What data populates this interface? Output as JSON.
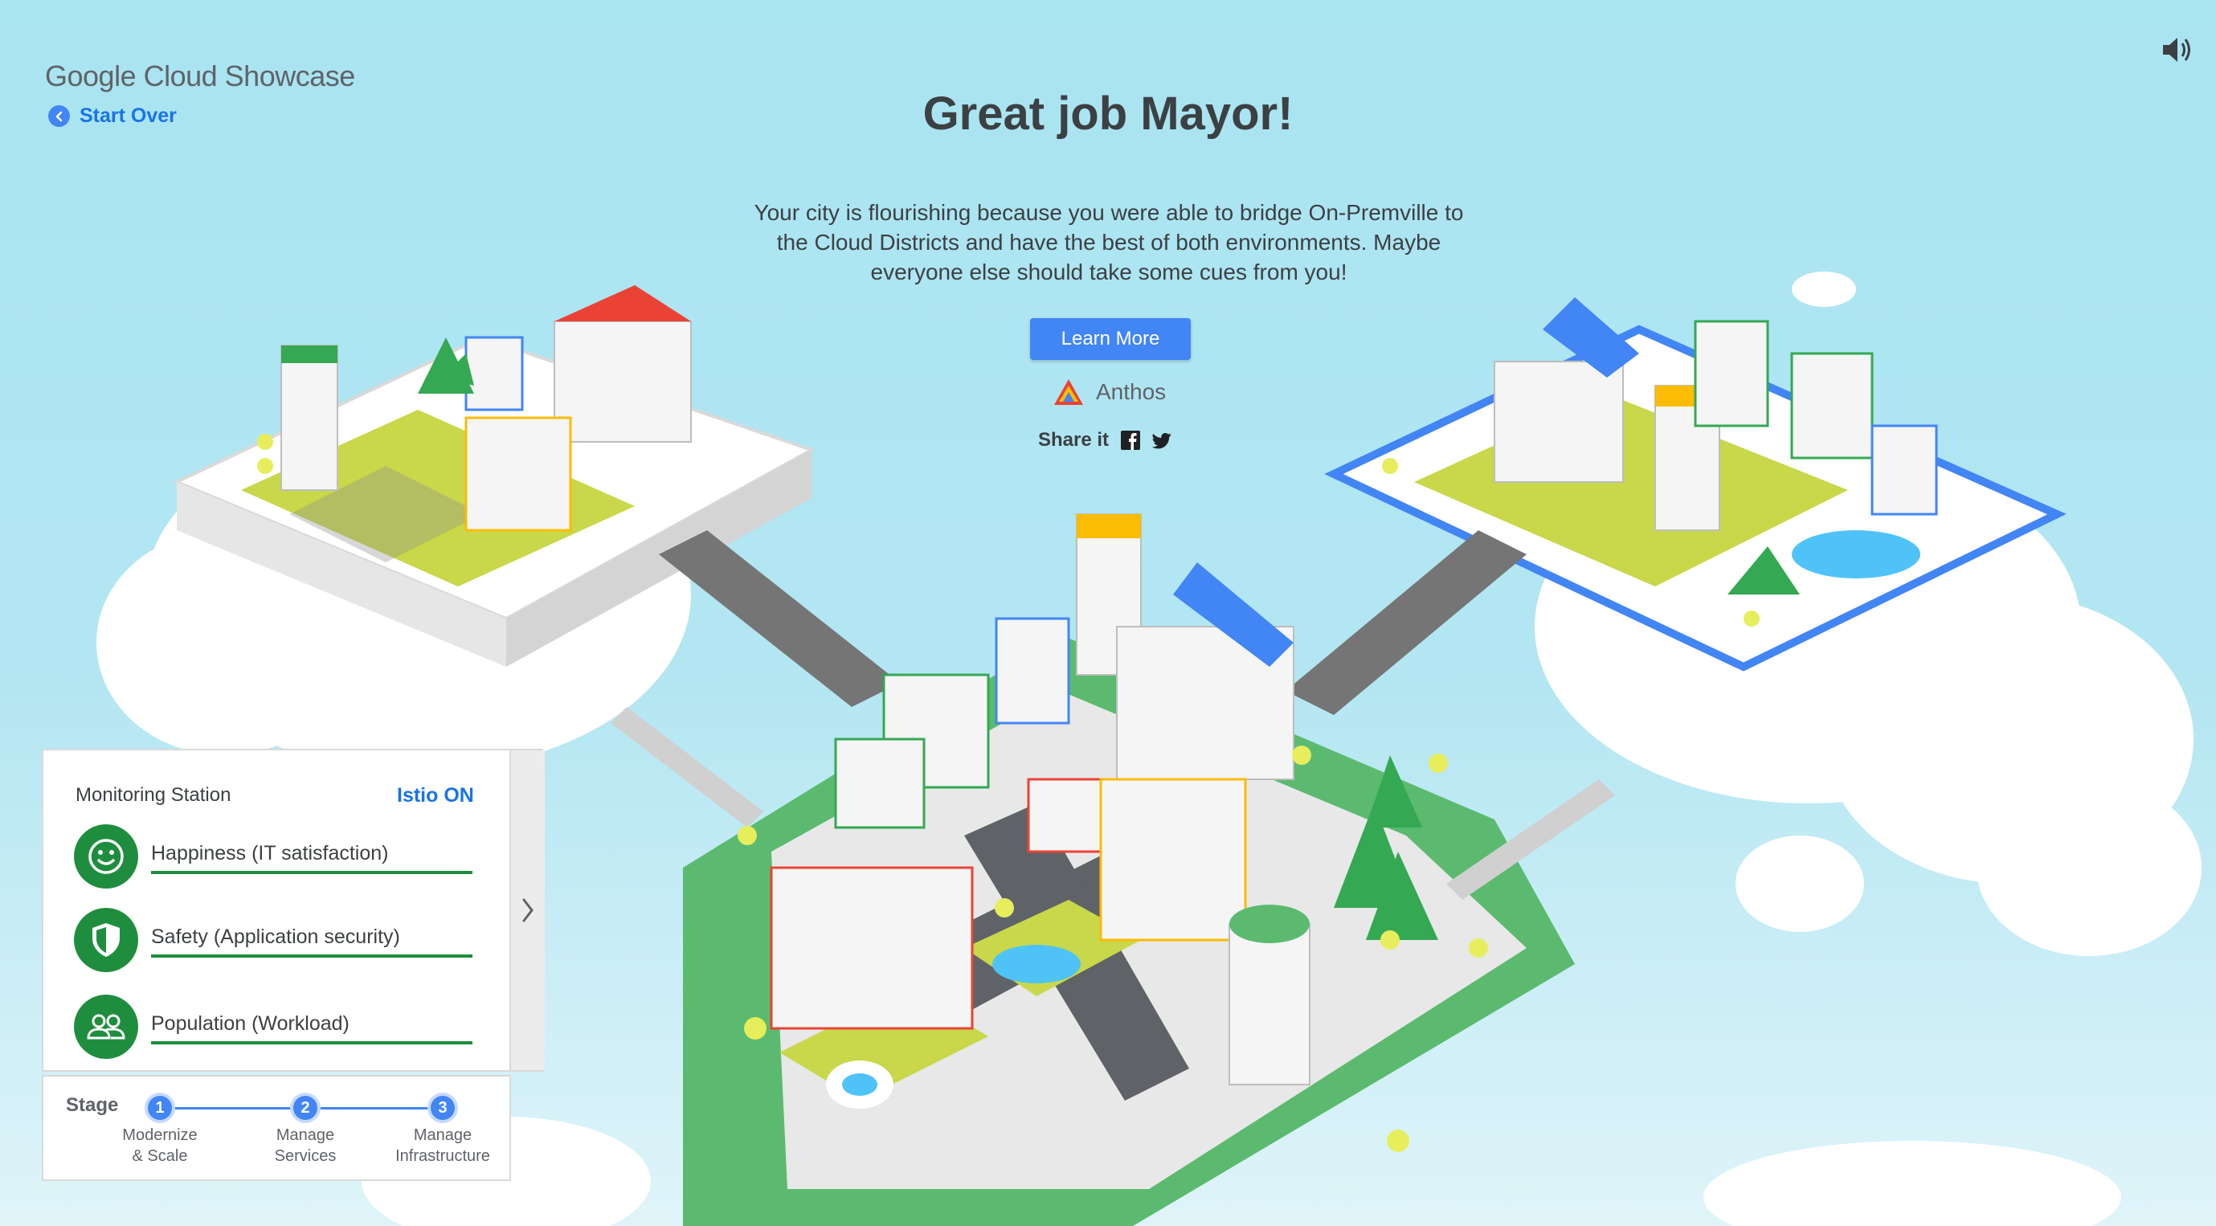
{
  "brand": {
    "google": "Google",
    "product": "Cloud Showcase"
  },
  "nav": {
    "start_over": "Start Over"
  },
  "headline": "Great job Mayor!",
  "message": "Your city is flourishing because you were able to bridge On-Premville to the Cloud Districts and have the best of both environments. Maybe everyone else should take some cues from you!",
  "cta": {
    "learn_more": "Learn More",
    "product": "Anthos",
    "share": "Share it"
  },
  "icons": {
    "sound": "speaker-icon",
    "back": "chevron-left-icon",
    "facebook": "facebook-icon",
    "twitter": "twitter-icon",
    "anthos": "anthos-logo-icon",
    "happiness": "smiley-icon",
    "safety": "shield-icon",
    "population": "people-icon",
    "expand": "chevron-right-icon"
  },
  "monitoring": {
    "title": "Monitoring Station",
    "istio": "Istio ON",
    "metrics": [
      {
        "label": "Happiness (IT satisfaction)"
      },
      {
        "label": "Safety (Application security)"
      },
      {
        "label": "Population (Workload)"
      }
    ]
  },
  "stage": {
    "title": "Stage",
    "steps": [
      {
        "num": "1",
        "label1": "Modernize",
        "label2": "& Scale"
      },
      {
        "num": "2",
        "label1": "Manage",
        "label2": "Services"
      },
      {
        "num": "3",
        "label1": "Manage",
        "label2": "Infrastructure"
      }
    ]
  },
  "colors": {
    "accent": "#4285f4",
    "green": "#1e8e3e",
    "grass": "#5bba6f",
    "sky": "#a9e4f1"
  }
}
